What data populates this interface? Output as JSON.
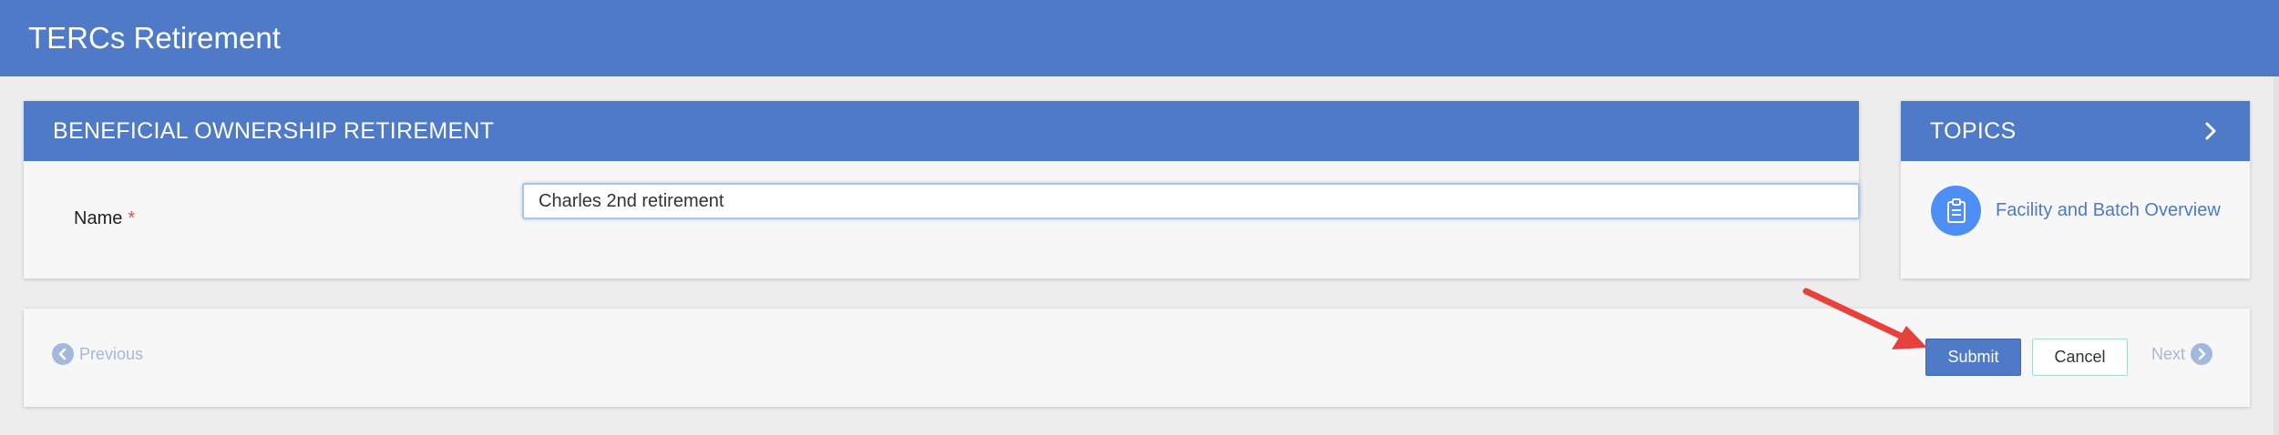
{
  "app": {
    "title": "TERCs Retirement"
  },
  "main_panel": {
    "title": "BENEFICIAL OWNERSHIP RETIREMENT",
    "name_label": "Name",
    "required_marker": "*",
    "name_value": "Charles 2nd retirement"
  },
  "topics": {
    "title": "TOPICS",
    "items": [
      {
        "label": "Facility and Batch Overview",
        "icon": "clipboard-icon"
      }
    ]
  },
  "footer": {
    "previous_label": "Previous",
    "submit_label": "Submit",
    "cancel_label": "Cancel",
    "next_label": "Next"
  },
  "colors": {
    "header_blue": "#4e7ac7",
    "topic_icon_blue": "#4e8ef7",
    "annotation_arrow": "#e8403a",
    "required_red": "#d9534f"
  }
}
